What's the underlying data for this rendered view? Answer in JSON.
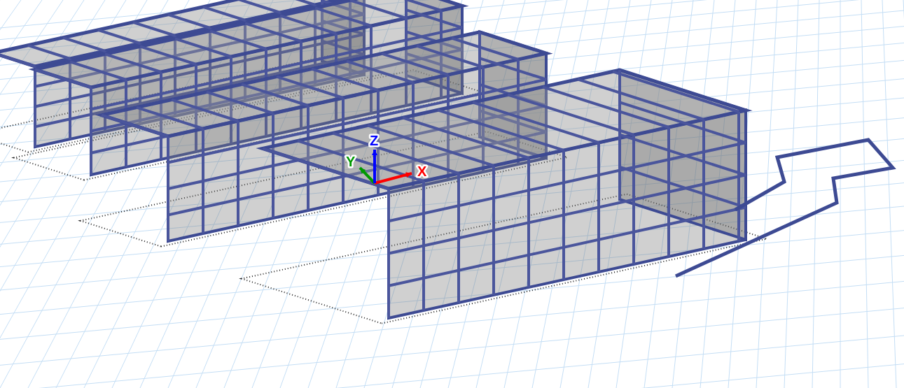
{
  "viewport": {
    "axes": [
      {
        "kind": "x",
        "label": "X",
        "color": "#ff0000"
      },
      {
        "kind": "y",
        "label": "Y",
        "color": "#009900"
      },
      {
        "kind": "z",
        "label": "Z",
        "color": "#0000ff"
      }
    ]
  }
}
